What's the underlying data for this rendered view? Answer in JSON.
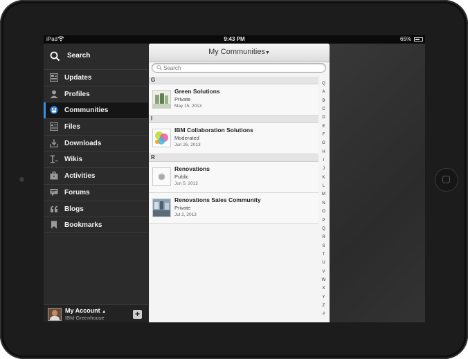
{
  "status_bar": {
    "device": "iPad",
    "time": "9:43 PM",
    "battery": "65%",
    "battery_level": 0.65
  },
  "sidebar": {
    "search_label": "Search",
    "items": [
      {
        "label": "Updates",
        "icon": "updates-icon"
      },
      {
        "label": "Profiles",
        "icon": "profile-icon"
      },
      {
        "label": "Communities",
        "icon": "communities-icon",
        "active": true
      },
      {
        "label": "Files",
        "icon": "files-icon"
      },
      {
        "label": "Downloads",
        "icon": "download-icon"
      },
      {
        "label": "Wikis",
        "icon": "wiki-icon"
      },
      {
        "label": "Activities",
        "icon": "briefcase-icon"
      },
      {
        "label": "Forums",
        "icon": "speech-bubble-icon"
      },
      {
        "label": "Blogs",
        "icon": "quote-icon"
      },
      {
        "label": "Bookmarks",
        "icon": "bookmark-icon"
      }
    ],
    "account": {
      "name": "My Account",
      "org": "IBM Greenhouse",
      "add_label": "+"
    }
  },
  "panel": {
    "title": "My Communities",
    "search_placeholder": "Search",
    "sections": [
      {
        "letter": "G",
        "rows": [
          {
            "name": "Green Solutions",
            "access": "Private",
            "date": "May 15, 2013"
          }
        ]
      },
      {
        "letter": "I",
        "rows": [
          {
            "name": "IBM Collaboration Solutions",
            "access": "Moderated",
            "date": "Jun 26, 2013"
          }
        ]
      },
      {
        "letter": "R",
        "rows": [
          {
            "name": "Renovations",
            "access": "Public",
            "date": "Jun 5, 2012"
          },
          {
            "name": "Renovations Sales Community",
            "access": "Private",
            "date": "Jul 2, 2013"
          }
        ]
      }
    ],
    "index_letters": [
      "Q",
      "A",
      "B",
      "C",
      "D",
      "E",
      "F",
      "G",
      "H",
      "I",
      "J",
      "K",
      "L",
      "M",
      "N",
      "O",
      "P",
      "Q",
      "R",
      "S",
      "T",
      "U",
      "V",
      "W",
      "X",
      "Y",
      "Z",
      "#"
    ]
  },
  "colors": {
    "accent": "#3b8ede",
    "sidebar_bg": "#2b2b2b",
    "panel_bg": "#f4f4f4"
  }
}
